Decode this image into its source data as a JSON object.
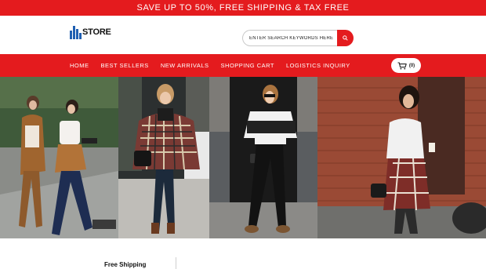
{
  "promo": {
    "text": "SAVE UP TO 50%, FREE SHIPPING & TAX FREE"
  },
  "header": {
    "logo_text": "STORE",
    "search_placeholder": "ENTER SEARCH KEYWORDS HERE"
  },
  "nav": {
    "items": [
      {
        "label": "HOME"
      },
      {
        "label": "BEST SELLERS"
      },
      {
        "label": "NEW ARRIVALS"
      },
      {
        "label": "SHOPPING CART"
      },
      {
        "label": "LOGISTICS INQUIRY"
      }
    ],
    "cart_count": "(0)"
  },
  "hero": {
    "slides": [
      {
        "icon": "street-fashion-photo"
      },
      {
        "icon": "plaid-poncho-photo"
      },
      {
        "icon": "striped-top-photo"
      },
      {
        "icon": "brick-wall-outfit-photo"
      }
    ]
  },
  "features": {
    "items": [
      {
        "title": "Free Shipping"
      }
    ]
  },
  "colors": {
    "accent": "#e41b1e",
    "brand_blue": "#1f5fb2"
  }
}
